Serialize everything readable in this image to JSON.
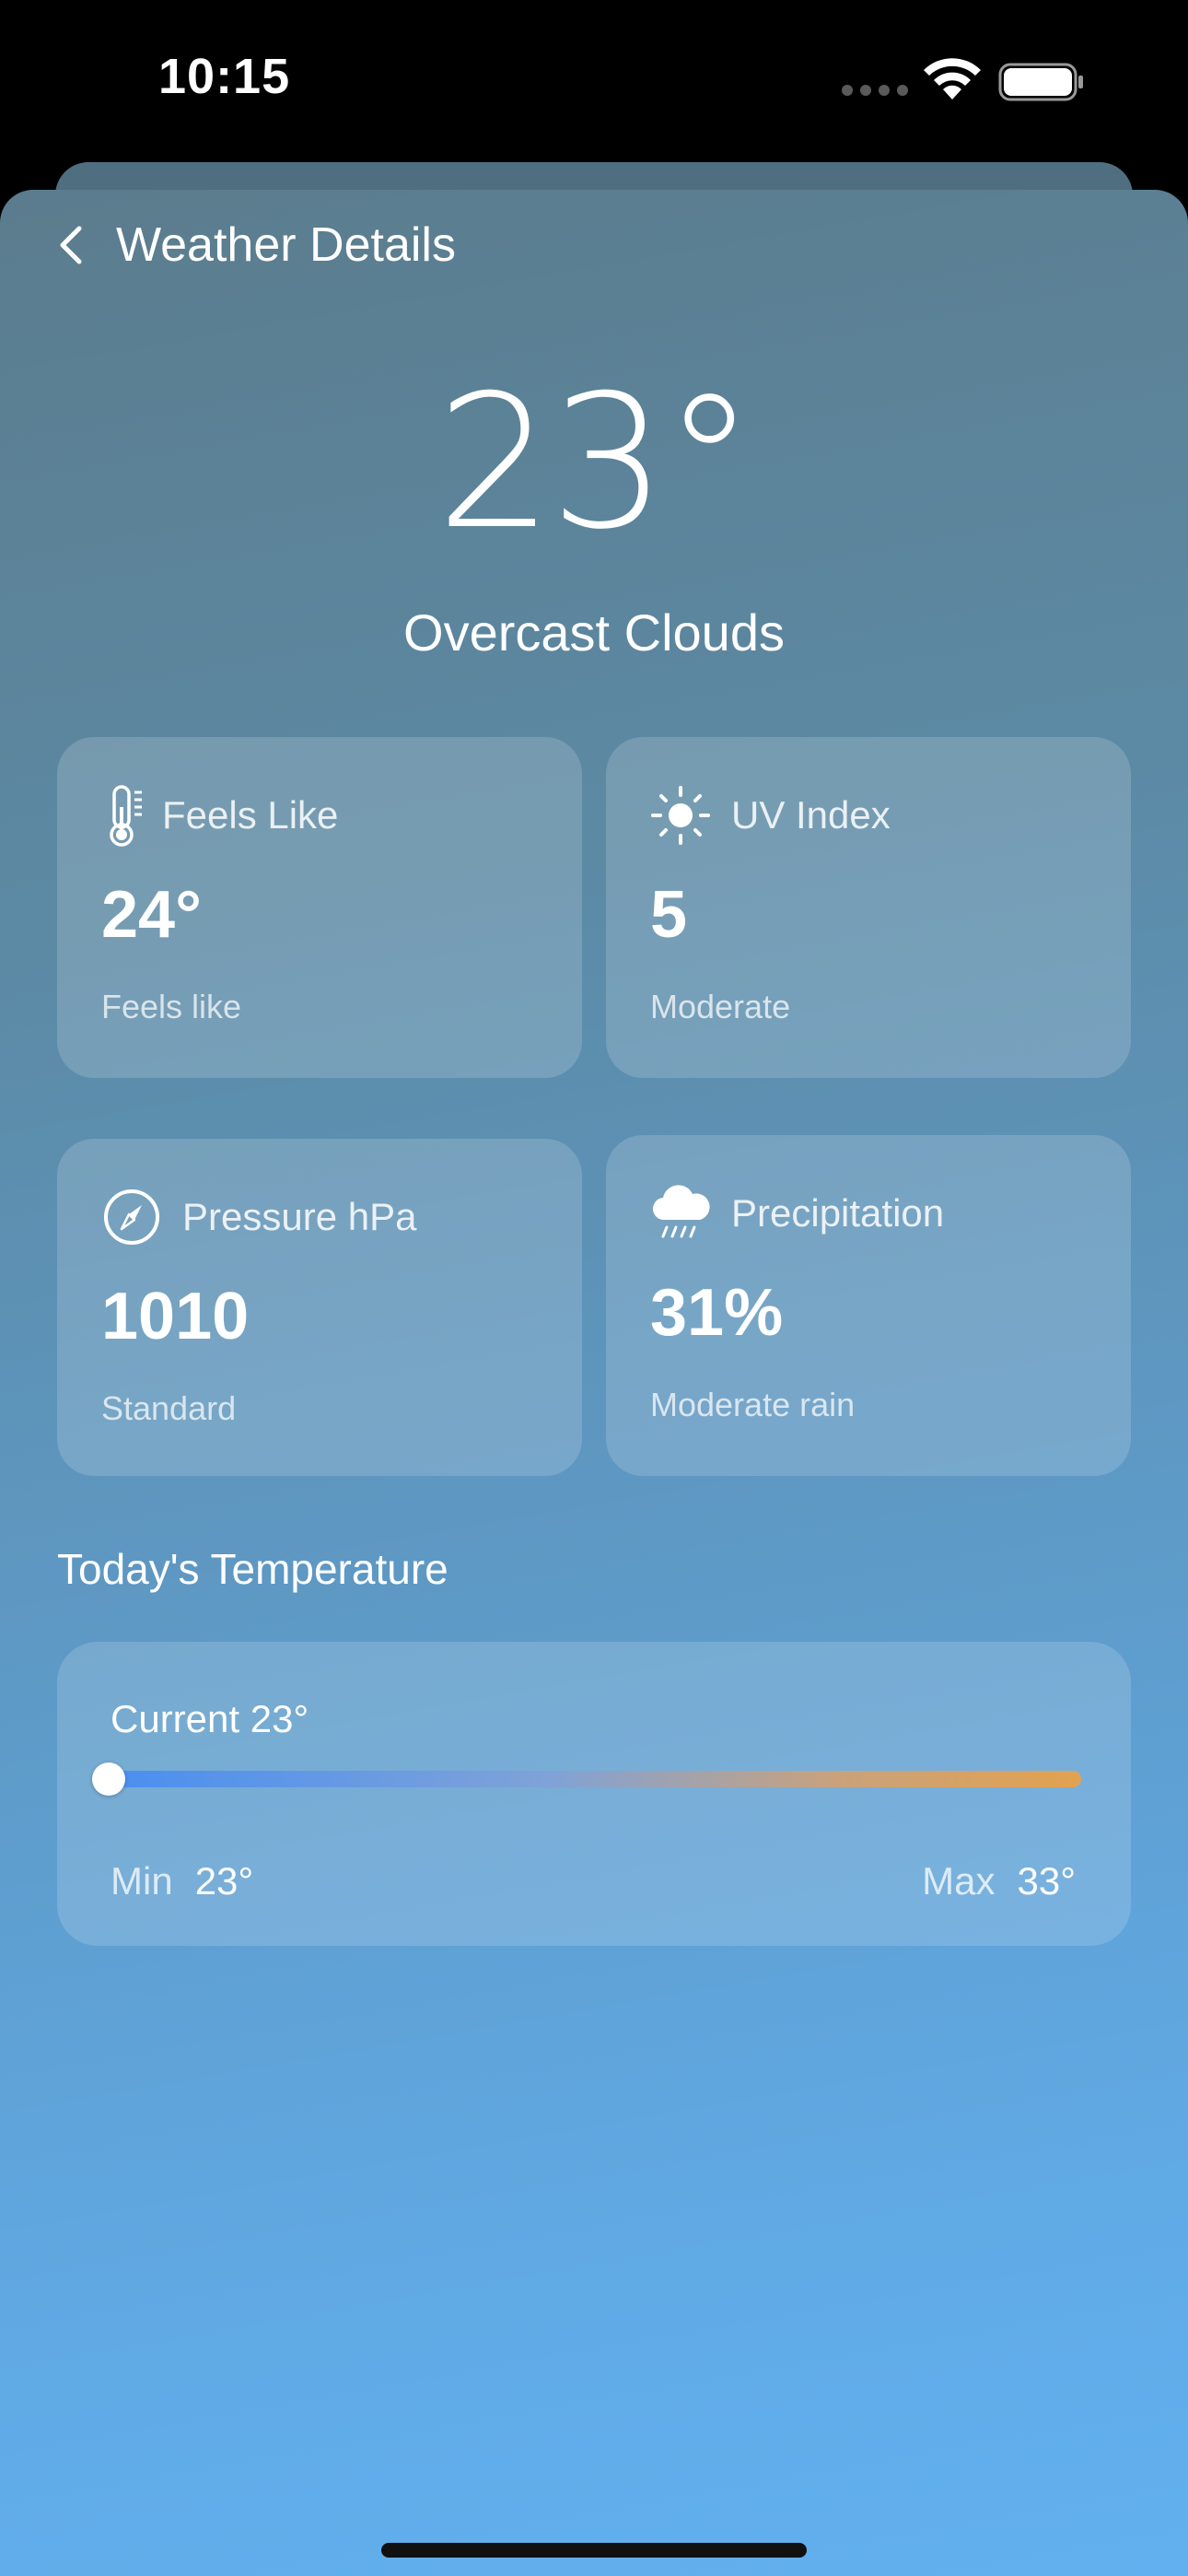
{
  "status_bar": {
    "time": "10:15",
    "icons": [
      "signal-dots-icon",
      "wifi-icon",
      "battery-icon"
    ]
  },
  "header": {
    "back_icon": "chevron-left-icon",
    "title": "Weather Details"
  },
  "current": {
    "temperature": "23°",
    "condition": "Overcast Clouds"
  },
  "cards": [
    {
      "icon": "thermometer-icon",
      "label": "Feels Like",
      "value": "24°",
      "sub": "Feels like"
    },
    {
      "icon": "sun-icon",
      "label": "UV Index",
      "value": "5",
      "sub": "Moderate"
    },
    {
      "icon": "gauge-icon",
      "label": "Pressure hPa",
      "value": "1010",
      "sub": "Standard"
    },
    {
      "icon": "cloud-rain-icon",
      "label": "Precipitation",
      "value": "31%",
      "sub": "Moderate rain"
    }
  ],
  "today": {
    "title": "Today's Temperature",
    "current_label": "Current 23°",
    "min_label": "Min",
    "min_value": "23°",
    "max_label": "Max",
    "max_value": "33°",
    "position_fraction": 0.0
  },
  "colors": {
    "gradient_top": "#5b7c8d",
    "gradient_bottom": "#62b0ef",
    "bar_cold": "#4a8ff0",
    "bar_hot": "#e2a24f"
  }
}
